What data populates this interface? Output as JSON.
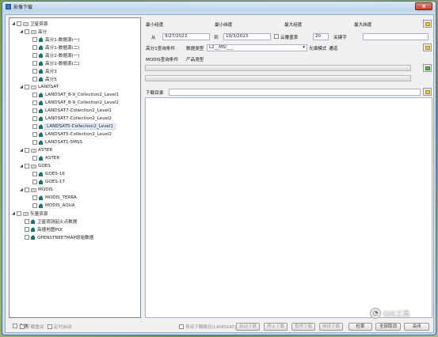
{
  "window": {
    "title": "影像下载",
    "close_label": "×"
  },
  "tree": [
    {
      "level": 0,
      "type": "folder",
      "expanded": true,
      "label": "卫星资源"
    },
    {
      "level": 1,
      "type": "folder",
      "expanded": true,
      "label": "高分"
    },
    {
      "level": 2,
      "type": "leaf",
      "label": "高分1-数据源(一)"
    },
    {
      "level": 2,
      "type": "leaf",
      "label": "高分1-数据源(二)"
    },
    {
      "level": 2,
      "type": "leaf",
      "label": "高分2-数据源(一)"
    },
    {
      "level": 2,
      "type": "leaf",
      "label": "高分2-数据源(二)"
    },
    {
      "level": 2,
      "type": "leaf",
      "label": "高分3"
    },
    {
      "level": 2,
      "type": "leaf",
      "label": "高分5"
    },
    {
      "level": 1,
      "type": "folder",
      "expanded": true,
      "label": "LANDSAT"
    },
    {
      "level": 2,
      "type": "leaf",
      "label": "LANDSAT_8-9_Collection2_Level1"
    },
    {
      "level": 2,
      "type": "leaf",
      "label": "LANDSAT_8-9_Collection2_Level2"
    },
    {
      "level": 2,
      "type": "leaf",
      "label": "LANDSAT7-Collection2_Level1"
    },
    {
      "level": 2,
      "type": "leaf",
      "label": "LANDSAT7-Collection2_Level2"
    },
    {
      "level": 2,
      "type": "leaf",
      "label": "LANDSAT5-Collection2_Level1",
      "selected": true
    },
    {
      "level": 2,
      "type": "leaf",
      "label": "LANDSAT5-Collection2_Level2"
    },
    {
      "level": 2,
      "type": "leaf",
      "label": "LANDSAT1-5MSS"
    },
    {
      "level": 1,
      "type": "folder",
      "expanded": true,
      "label": "ASTER"
    },
    {
      "level": 2,
      "type": "leaf",
      "label": "ASTER"
    },
    {
      "level": 1,
      "type": "folder",
      "expanded": true,
      "label": "GOES"
    },
    {
      "level": 2,
      "type": "leaf",
      "label": "GOES-16"
    },
    {
      "level": 2,
      "type": "leaf",
      "label": "GOES-17"
    },
    {
      "level": 1,
      "type": "folder",
      "expanded": true,
      "label": "MODIS"
    },
    {
      "level": 2,
      "type": "leaf",
      "label": "MODIS_TERRA"
    },
    {
      "level": 2,
      "type": "leaf",
      "label": "MODIS_AQUA"
    },
    {
      "level": 0,
      "type": "folder",
      "expanded": true,
      "label": "矢量资源"
    },
    {
      "level": 1,
      "type": "leaf",
      "label": "卫星观测起火点数据"
    },
    {
      "level": 1,
      "type": "leaf",
      "label": "高德地图POI"
    },
    {
      "level": 1,
      "type": "leaf",
      "label": "OPENSTREETMAP原始数据"
    }
  ],
  "select_all": "全选",
  "bbox": {
    "min_lon": "最小经度",
    "min_lat": "最小纬度",
    "max_lon": "最大经度",
    "max_lat": "最大纬度"
  },
  "date": {
    "from_label": "从",
    "from": "9/27/2023",
    "to_label": "到",
    "to": "10/3/2023",
    "cloud_label": "云覆盖率",
    "cloud": "20",
    "keyword_label": "关键字",
    "keyword": ""
  },
  "gaofen": {
    "label": "高分1查询条件",
    "dtype_label": "数据类型",
    "dtype": "L2__MSI___",
    "mode_label": "光谱模式",
    "mode": "通道"
  },
  "modis": {
    "label": "MODIS查询条件",
    "ptype_label": "产品类型"
  },
  "download_dir_label": "下载目录",
  "bottom": {
    "resume": "下载重试",
    "auto_start": "定时启动",
    "export_paths": "导出下载路径(LANDSAT)",
    "btn_start": "启动下载",
    "btn_stop": "停止下载",
    "btn_pause": "暂停下载",
    "btn_continue": "继续下载",
    "btn_search": "检索",
    "btn_cancel_all": "全部取消",
    "btn_close": "关闭"
  },
  "watermark": "GIS工具"
}
